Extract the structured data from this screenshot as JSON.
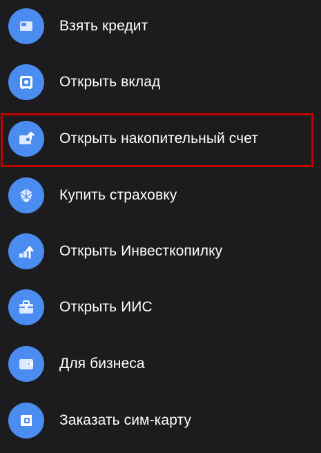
{
  "colors": {
    "background": "#1c1c1e",
    "icon_bg": "#4b8cf0",
    "highlight_border": "#c00000",
    "text": "#ffffff"
  },
  "menu": {
    "items": [
      {
        "label": "Взять кредит",
        "icon": "credit-card-icon"
      },
      {
        "label": "Открыть вклад",
        "icon": "safe-icon"
      },
      {
        "label": "Открыть накопительный счет",
        "icon": "savings-wallet-icon",
        "highlighted": true
      },
      {
        "label": "Купить страховку",
        "icon": "umbrella-icon"
      },
      {
        "label": "Открыть Инвесткопилку",
        "icon": "investment-growth-icon"
      },
      {
        "label": "Открыть ИИС",
        "icon": "briefcase-icon"
      },
      {
        "label": "Для бизнеса",
        "icon": "wallet-icon"
      },
      {
        "label": "Заказать сим-карту",
        "icon": "sim-card-icon"
      }
    ]
  }
}
